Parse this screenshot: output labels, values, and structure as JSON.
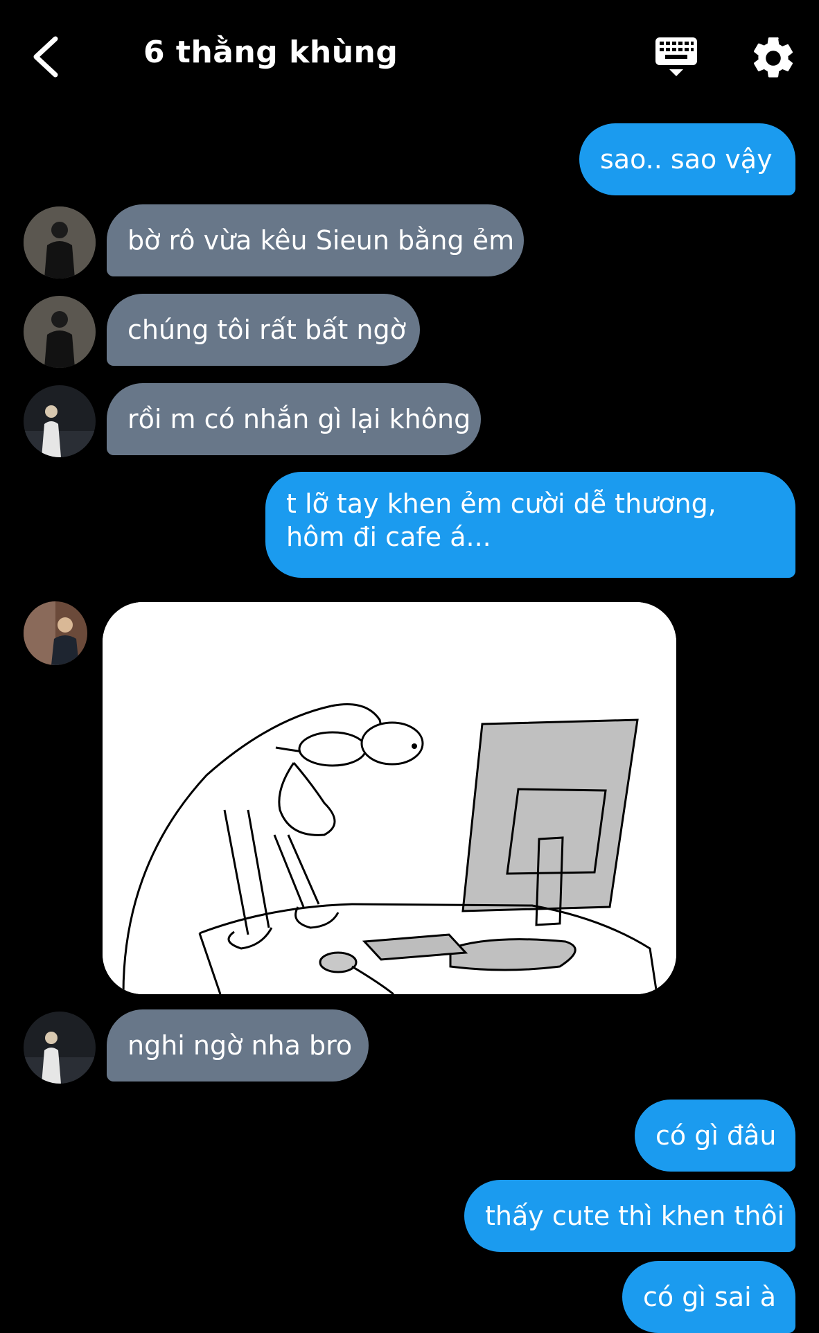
{
  "header": {
    "title": "6 thằng khùng",
    "back_icon": "chevron-left-icon",
    "keyboard_icon": "keyboard-icon",
    "settings_icon": "gear-icon"
  },
  "colors": {
    "background": "#000000",
    "outgoing_bubble": "#1b9bef",
    "incoming_bubble": "#687789",
    "text": "#ffffff"
  },
  "messages": [
    {
      "side": "out",
      "text": "sao.. sao vậy"
    },
    {
      "side": "in",
      "text": "bờ rô vừa kêu Sieun bằng ẻm"
    },
    {
      "side": "in",
      "text": "chúng tôi rất bất ngờ"
    },
    {
      "side": "in",
      "text": "rồi m có nhắn gì lại không"
    },
    {
      "side": "out",
      "text": "t lỡ tay khen ẻm cười dễ thương, hôm đi cafe á..."
    },
    {
      "side": "in",
      "type": "image",
      "image_icon": "stick-figure-at-computer-drawing"
    },
    {
      "side": "in",
      "text": "nghi ngờ nha bro"
    },
    {
      "side": "out",
      "text": "có gì đâu"
    },
    {
      "side": "out",
      "text": "thấy cute thì khen thôi"
    },
    {
      "side": "out",
      "text": "có gì sai à"
    }
  ]
}
